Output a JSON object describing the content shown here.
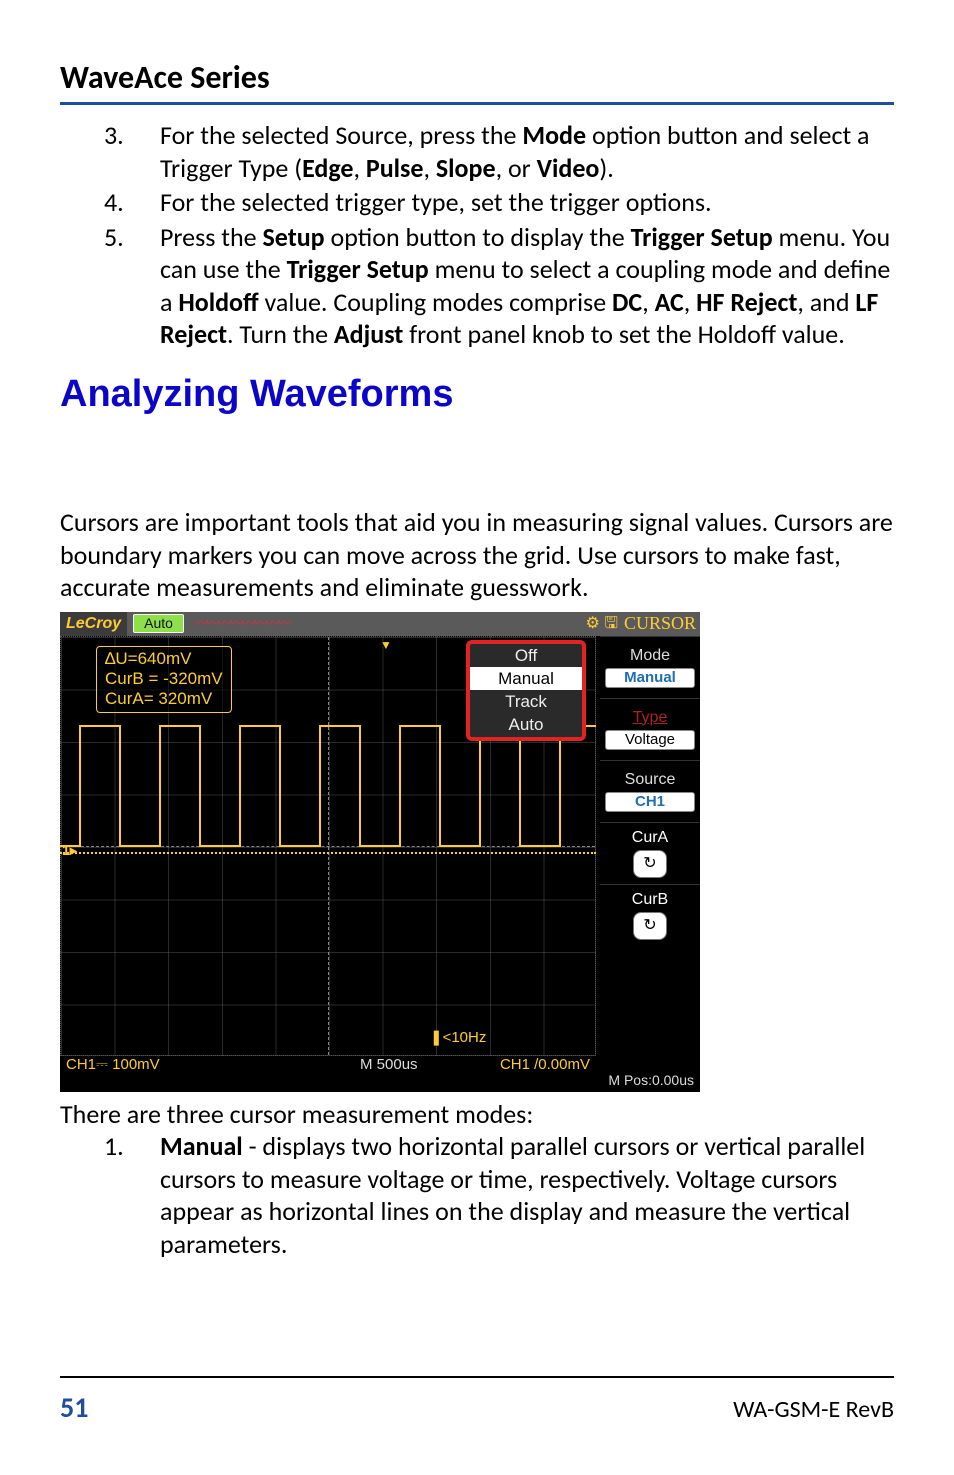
{
  "header": {
    "series": "WaveAce Series"
  },
  "steps": [
    {
      "n": "3.",
      "parts": [
        "For the selected Source, press the ",
        "Mode",
        " option button and select a Trigger Type (",
        "Edge",
        ", ",
        "Pulse",
        ", ",
        "Slope",
        ", or ",
        "Video",
        ")."
      ]
    },
    {
      "n": "4.",
      "parts": [
        "For the selected trigger type, set the trigger options."
      ]
    },
    {
      "n": "5.",
      "parts": [
        "Press the ",
        "Setup",
        " option button to display the ",
        "Trigger Setup",
        " menu. You can use the ",
        "Trigger Setup",
        " menu to select a coupling mode and define a ",
        "Holdoff",
        " value. Coupling modes comprise ",
        "DC",
        ", ",
        "AC",
        ", ",
        "HF Reject",
        ", and ",
        "LF Reject",
        ". Turn the ",
        "Adjust",
        " front panel knob to set the Holdoff value."
      ]
    }
  ],
  "section_heading": "Analyzing Waveforms",
  "intro": "Cursors are important tools that aid you in measuring signal values. Cursors are boundary markers you can move across the grid. Use cursors to make fast, accurate measurements and eliminate guesswork.",
  "scope": {
    "brand": "LeCroy",
    "trigger_mode": "Auto",
    "title_right": "CURSOR",
    "delta": {
      "dU": "∆U=640mV",
      "curB": "CurB = -320mV",
      "curA": "CurA= 320mV"
    },
    "mode_menu": {
      "items": [
        "Off",
        "Manual",
        "Track",
        "Auto"
      ],
      "selected": "Manual"
    },
    "side": {
      "mode": {
        "label": "Mode",
        "value": "Manual"
      },
      "type": {
        "label": "Type",
        "value": "Voltage"
      },
      "source": {
        "label": "Source",
        "value": "CH1"
      },
      "curA": {
        "label": "CurA"
      },
      "curB": {
        "label": "CurB"
      }
    },
    "bottom": {
      "ch1": "CH1⎓ 100mV",
      "timebase": "M 500us",
      "ch1v": "CH1 /0.00mV",
      "mpos": "M Pos:0.00us",
      "freq": "❚<10Hz"
    },
    "ch_marker": "1▸"
  },
  "after_scope": "There are three cursor measurement modes:",
  "modes_list": {
    "n": "1.",
    "bold": "Manual",
    "text": " - displays two horizontal parallel cursors or vertical parallel cursors to measure voltage or time, respectively. Voltage cursors appear as horizontal lines on the display and measure the vertical parameters."
  },
  "footer": {
    "page": "51",
    "rev": "WA-GSM-E RevB"
  }
}
